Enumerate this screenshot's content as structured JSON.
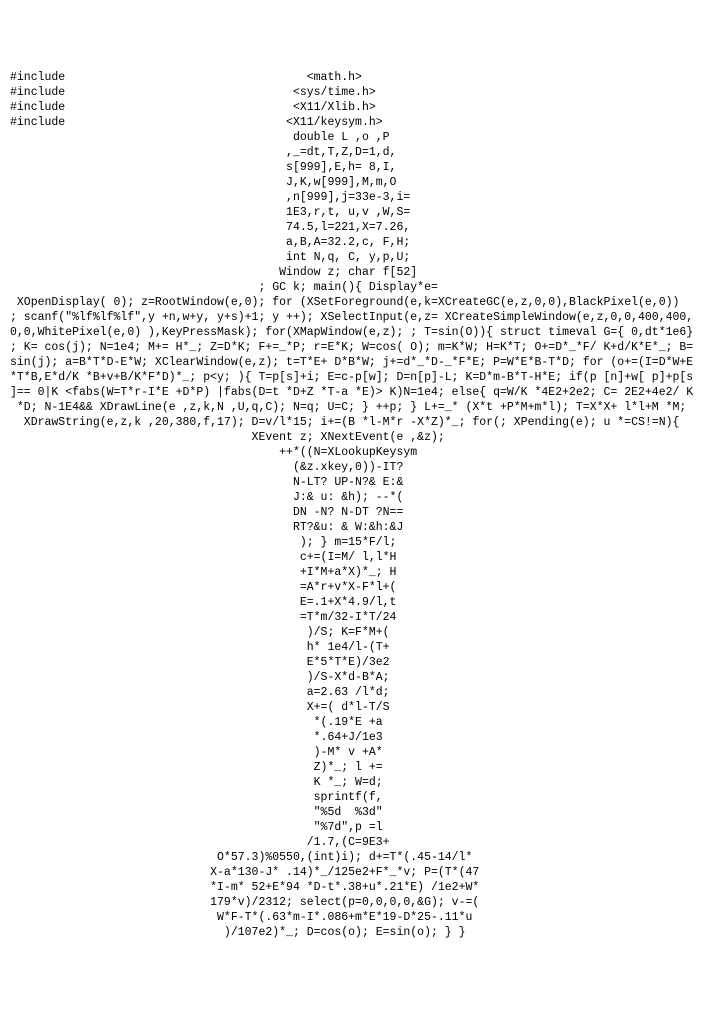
{
  "lines": [
    "#include                                   <math.h>",
    "#include                                 <sys/time.h>",
    "#include                                 <X11/Xlib.h>",
    "#include                                <X11/keysym.h>",
    "                                         double L ,o ,P",
    "                                        ,_=dt,T,Z,D=1,d,",
    "                                        s[999],E,h= 8,I,",
    "                                        J,K,w[999],M,m,O",
    "                                        ,n[999],j=33e-3,i=",
    "                                        1E3,r,t, u,v ,W,S=",
    "                                        74.5,l=221,X=7.26,",
    "                                        a,B,A=32.2,c, F,H;",
    "                                        int N,q, C, y,p,U;",
    "                                       Window z; char f[52]",
    "                                    ; GC k; main(){ Display*e=",
    " XOpenDisplay( 0); z=RootWindow(e,0); for (XSetForeground(e,k=XCreateGC(e,z,0,0),BlackPixel(e,0))",
    "; scanf(\"%lf%lf%lf\",y +n,w+y, y+s)+1; y ++); XSelectInput(e,z= XCreateSimpleWindow(e,z,0,0,400,400,",
    "0,0,WhitePixel(e,0) ),KeyPressMask); for(XMapWindow(e,z); ; T=sin(O)){ struct timeval G={ 0,dt*1e6}",
    "; K= cos(j); N=1e4; M+= H*_; Z=D*K; F+=_*P; r=E*K; W=cos( O); m=K*W; H=K*T; O+=D*_*F/ K+d/K*E*_; B=",
    "sin(j); a=B*T*D-E*W; XClearWindow(e,z); t=T*E+ D*B*W; j+=d*_*D-_*F*E; P=W*E*B-T*D; for (o+=(I=D*W+E",
    "*T*B,E*d/K *B+v+B/K*F*D)*_; p<y; ){ T=p[s]+i; E=c-p[w]; D=n[p]-L; K=D*m-B*T-H*E; if(p [n]+w[ p]+p[s",
    "]== 0|K <fabs(W=T*r-I*E +D*P) |fabs(D=t *D+Z *T-a *E)> K)N=1e4; else{ q=W/K *4E2+2e2; C= 2E2+4e2/ K",
    " *D; N-1E4&& XDrawLine(e ,z,k,N ,U,q,C); N=q; U=C; } ++p; } L+=_* (X*t +P*M+m*l); T=X*X+ l*l+M *M;",
    "  XDrawString(e,z,k ,20,380,f,17); D=v/l*15; i+=(B *l-M*r -X*Z)*_; for(; XPending(e); u *=CS!=N){",
    "                                   XEvent z; XNextEvent(e ,&z);",
    "                                       ++*((N=XLookupKeysym",
    "                                         (&z.xkey,0))-IT?",
    "                                         N-LT? UP-N?& E:&",
    "                                         J:& u: &h); --*(",
    "                                         DN -N? N-DT ?N==",
    "                                         RT?&u: & W:&h:&J",
    "                                          ); } m=15*F/l;",
    "                                          c+=(I=M/ l,l*H",
    "                                          +I*M+a*X)*_; H",
    "                                          =A*r+v*X-F*l+(",
    "                                          E=.1+X*4.9/l,t",
    "                                          =T*m/32-I*T/24",
    "                                           )/S; K=F*M+(",
    "                                           h* 1e4/l-(T+",
    "                                           E*5*T*E)/3e2",
    "                                           )/S-X*d-B*A;",
    "                                           a=2.63 /l*d;",
    "                                           X+=( d*l-T/S",
    "                                            *(.19*E +a",
    "                                            *.64+J/1e3",
    "                                            )-M* v +A*",
    "                                            Z)*_; l +=",
    "                                            K *_; W=d;",
    "                                            sprintf(f,",
    "                                            \"%5d  %3d\"",
    "                                            \"%7d\",p =l",
    "                                           /1.7,(C=9E3+",
    "                              O*57.3)%0550,(int)i); d+=T*(.45-14/l*",
    "                             X-a*130-J* .14)*_/125e2+F*_*v; P=(T*(47",
    "                             *I-m* 52+E*94 *D-t*.38+u*.21*E) /1e2+W*",
    "                             179*v)/2312; select(p=0,0,0,0,&G); v-=(",
    "                              W*F-T*(.63*m-I*.086+m*E*19-D*25-.11*u",
    "                               )/107e2)*_; D=cos(o); E=sin(o); } }"
  ]
}
